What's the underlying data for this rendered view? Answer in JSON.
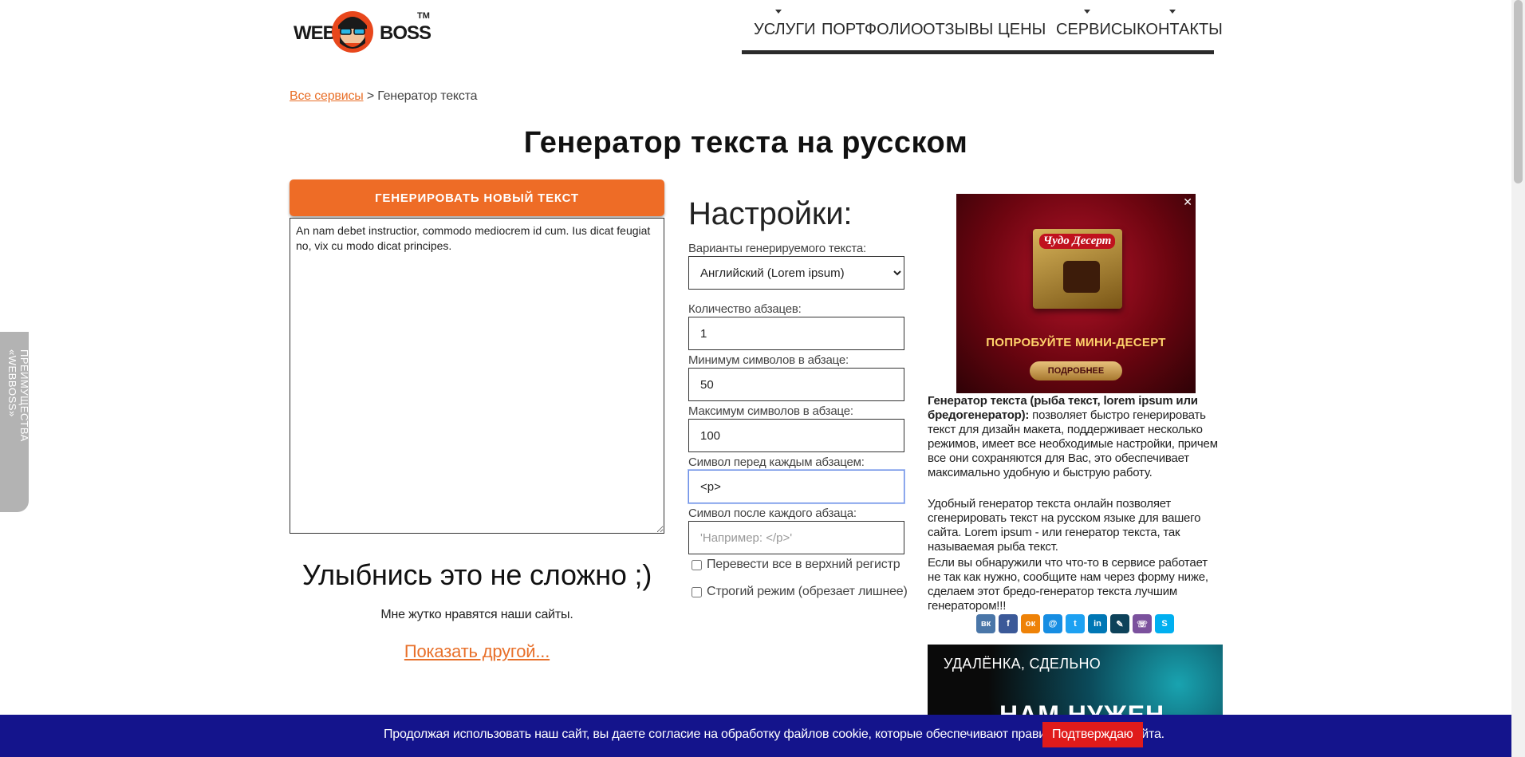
{
  "logo": {
    "word1": "WEB",
    "word2": "BOSS",
    "tm": "TM"
  },
  "nav": [
    {
      "label": "УСЛУГИ",
      "has_dropdown": true
    },
    {
      "label": "ПОРТФОЛИО",
      "has_dropdown": false
    },
    {
      "label": "ОТЗЫВЫ",
      "has_dropdown": false
    },
    {
      "label": "ЦЕНЫ",
      "has_dropdown": false
    },
    {
      "label": "СЕРВИСЫ",
      "has_dropdown": true
    },
    {
      "label": "КОНТАКТЫ",
      "has_dropdown": true
    }
  ],
  "breadcrumb": {
    "link": "Все сервисы",
    "separator": ">",
    "current": "Генератор текста"
  },
  "page_title": "Генератор текста на русском",
  "generator": {
    "button_label": "ГЕНЕРИРОВАТЬ НОВЫЙ ТЕКСТ",
    "output_text": "An nam debet instructior, commodo mediocrem id cum. Ius dicat feugiat no, vix cu modo dicat principes."
  },
  "smile": {
    "heading": "Улыбнись это не сложно ;)",
    "subtext": "Мне жутко нравятся наши сайты.",
    "link": "Показать другой..."
  },
  "settings": {
    "heading": "Настройки:",
    "variant_label": "Варианты генерируемого текста:",
    "variant_value": "Английский (Lorem ipsum)",
    "paragraphs_label": "Количество абзацев:",
    "paragraphs_value": "1",
    "min_label": "Минимум символов в абзаце:",
    "min_value": "50",
    "max_label": "Максимум символов в абзаце:",
    "max_value": "100",
    "before_label": "Символ перед каждым абзацем:",
    "before_value": "<p>",
    "after_label": "Символ после каждого абзаца:",
    "after_placeholder": "'Например: </p>'",
    "uppercase_label": "Перевести все в верхний регистр",
    "strict_label": "Строгий режим (обрезает лишнее)"
  },
  "ad": {
    "brand": "Чудо Десерт",
    "headline": "ПОПРОБУЙТЕ МИНИ-ДЕСЕРТ",
    "button": "ПОДРОБНЕЕ",
    "close": "✕"
  },
  "description": {
    "p1_bold": "Генератор текста (рыба текст, lorem ipsum или бредогенератор):",
    "p1_rest": " позволяет быстро генерировать текст для дизайн макета, поддерживает несколько режимов, имеет все необходимые настройки, причем все они сохраняются для Вас, это обеспечивает максимально удобную и быструю работу.",
    "p2": "Удобный генератор текста онлайн позволяет сгенерировать текст на русском языке для вашего сайта. Lorem ipsum - или генератор текста, так называемая рыба текст.",
    "p3": "Если вы обнаружили что что-то в сервисе работает не так как нужно, сообщите нам через форму ниже, сделаем этот бредо-генератор текста лучшим генератором!!!"
  },
  "share_icons": [
    {
      "name": "vk-icon",
      "glyph": "вк",
      "color": "#4a76a8"
    },
    {
      "name": "facebook-icon",
      "glyph": "f",
      "color": "#3b5998"
    },
    {
      "name": "odnoklassniki-icon",
      "glyph": "ок",
      "color": "#ee8208"
    },
    {
      "name": "moimir-icon",
      "glyph": "@",
      "color": "#168de2"
    },
    {
      "name": "twitter-icon",
      "glyph": "t",
      "color": "#1da1f2"
    },
    {
      "name": "linkedin-icon",
      "glyph": "in",
      "color": "#0077b5"
    },
    {
      "name": "livejournal-icon",
      "glyph": "✎",
      "color": "#0d425a"
    },
    {
      "name": "viber-icon",
      "glyph": "☏",
      "color": "#7b519d"
    },
    {
      "name": "skype-icon",
      "glyph": "S",
      "color": "#00aff0"
    }
  ],
  "banner2": {
    "line1": "УДАЛЁНКА, СДЕЛЬНО",
    "line2": "НАМ НУЖЕН"
  },
  "side_tab": "ПРЕИМУЩЕСТВА «WEBBOSS»",
  "cookie": {
    "message": "Продолжая использовать наш сайт, вы даете согласие на обработку файлов cookie, которые обеспечивают правильную работу сайта.",
    "button": "Подтверждаю"
  }
}
